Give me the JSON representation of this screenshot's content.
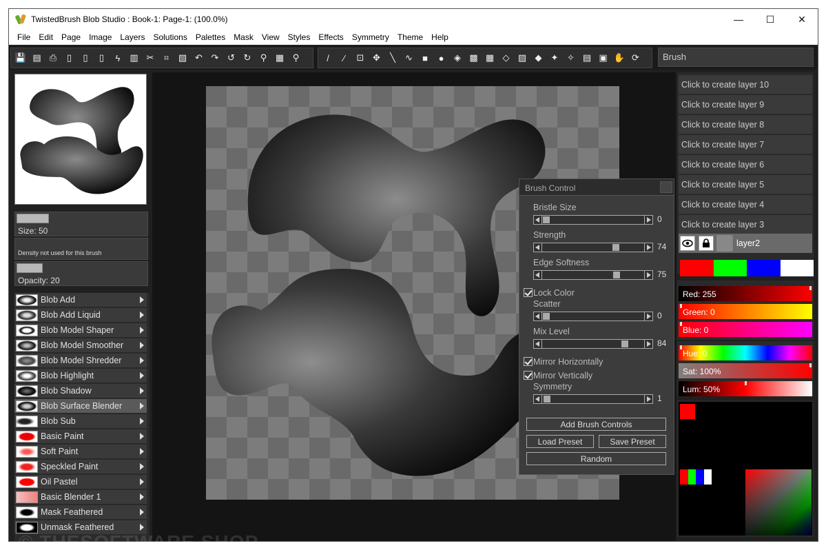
{
  "window": {
    "title": "TwistedBrush Blob Studio : Book-1: Page-1:  (100.0%)",
    "minimize": "—",
    "maximize": "☐",
    "close": "✕"
  },
  "menu": [
    "File",
    "Edit",
    "Page",
    "Image",
    "Layers",
    "Solutions",
    "Palettes",
    "Mask",
    "View",
    "Styles",
    "Effects",
    "Symmetry",
    "Theme",
    "Help"
  ],
  "toolbar": {
    "brush_field": "Brush",
    "group1_icons": [
      "save-icon",
      "save-as-icon",
      "export-icon",
      "page-icon",
      "new-page-icon",
      "copy-page-icon",
      "lightning-icon",
      "book-icon",
      "scissors-icon",
      "crop-icon",
      "paste-icon",
      "rotate-left-icon",
      "rotate-right-icon",
      "undo-icon",
      "redo-icon",
      "zoom-icon",
      "grid-icon",
      "zoom-out-icon"
    ],
    "group2_icons": [
      "pen-icon",
      "eyedropper-icon",
      "crop-tool-icon",
      "move-icon",
      "line-icon",
      "brush-tool-icon",
      "rectangle-icon",
      "ellipse-icon",
      "fill-icon",
      "checker-icon",
      "pattern-icon",
      "dither-icon",
      "noise-icon",
      "texture-icon",
      "sparkle-icon",
      "magic-wand-icon",
      "stamp-icon",
      "select-icon",
      "hand-icon",
      "refresh-icon"
    ]
  },
  "left_panel": {
    "size_label": "Size: 50",
    "size_value": 0.5,
    "density_label": "Density not used for this brush",
    "opacity_label": "Opacity: 20",
    "opacity_value": 0.2
  },
  "brushes": [
    {
      "name": "Blob Add",
      "selected": false
    },
    {
      "name": "Blob Add Liquid",
      "selected": false
    },
    {
      "name": "Blob Model Shaper",
      "selected": false
    },
    {
      "name": "Blob Model Smoother",
      "selected": false
    },
    {
      "name": "Blob Model Shredder",
      "selected": false
    },
    {
      "name": "Blob Highlight",
      "selected": false
    },
    {
      "name": "Blob Shadow",
      "selected": false
    },
    {
      "name": "Blob Surface Blender",
      "selected": true
    },
    {
      "name": "Blob Sub",
      "selected": false
    },
    {
      "name": "Basic Paint",
      "selected": false
    },
    {
      "name": "Soft Paint",
      "selected": false
    },
    {
      "name": "Speckled Paint",
      "selected": false
    },
    {
      "name": "Oil Pastel",
      "selected": false
    },
    {
      "name": "Basic Blender 1",
      "selected": false
    },
    {
      "name": "Mask Feathered",
      "selected": false
    },
    {
      "name": "Unmask Feathered",
      "selected": false
    }
  ],
  "brush_control": {
    "title": "Brush Control",
    "sliders": [
      {
        "label": "Bristle Size",
        "value": "0",
        "pos": 0
      },
      {
        "label": "Strength",
        "value": "74",
        "pos": 0.74
      },
      {
        "label": "Edge Softness",
        "value": "75",
        "pos": 0.75
      },
      {
        "label": "Scatter",
        "value": "0",
        "pos": 0
      },
      {
        "label": "Mix Level",
        "value": "84",
        "pos": 0.84
      },
      {
        "label": "Symmetry",
        "value": "1",
        "pos": 0.01
      }
    ],
    "lock_color": "Lock Color",
    "mirror_h": "Mirror Horizontally",
    "mirror_v": "Mirror Vertically",
    "add_controls": "Add Brush Controls",
    "load_preset": "Load Preset",
    "save_preset": "Save Preset",
    "random": "Random"
  },
  "layers": {
    "create": [
      "Click to create layer 10",
      "Click to create layer 9",
      "Click to create layer 8",
      "Click to create layer 7",
      "Click to create layer 6",
      "Click to create layer 5",
      "Click to create layer 4",
      "Click to create layer 3"
    ],
    "active": "layer2"
  },
  "colors": {
    "swatches": [
      "#ff0000",
      "#00ff00",
      "#0000ff",
      "#ffffff"
    ],
    "red": "Red: 255",
    "green": "Green: 0",
    "blue": "Blue: 0",
    "hue": "Hue: 0",
    "sat": "Sat: 100%",
    "lum": "Lum: 50%",
    "current": "#ff0000"
  },
  "watermark": "© THESOFTWARE.SHOP"
}
